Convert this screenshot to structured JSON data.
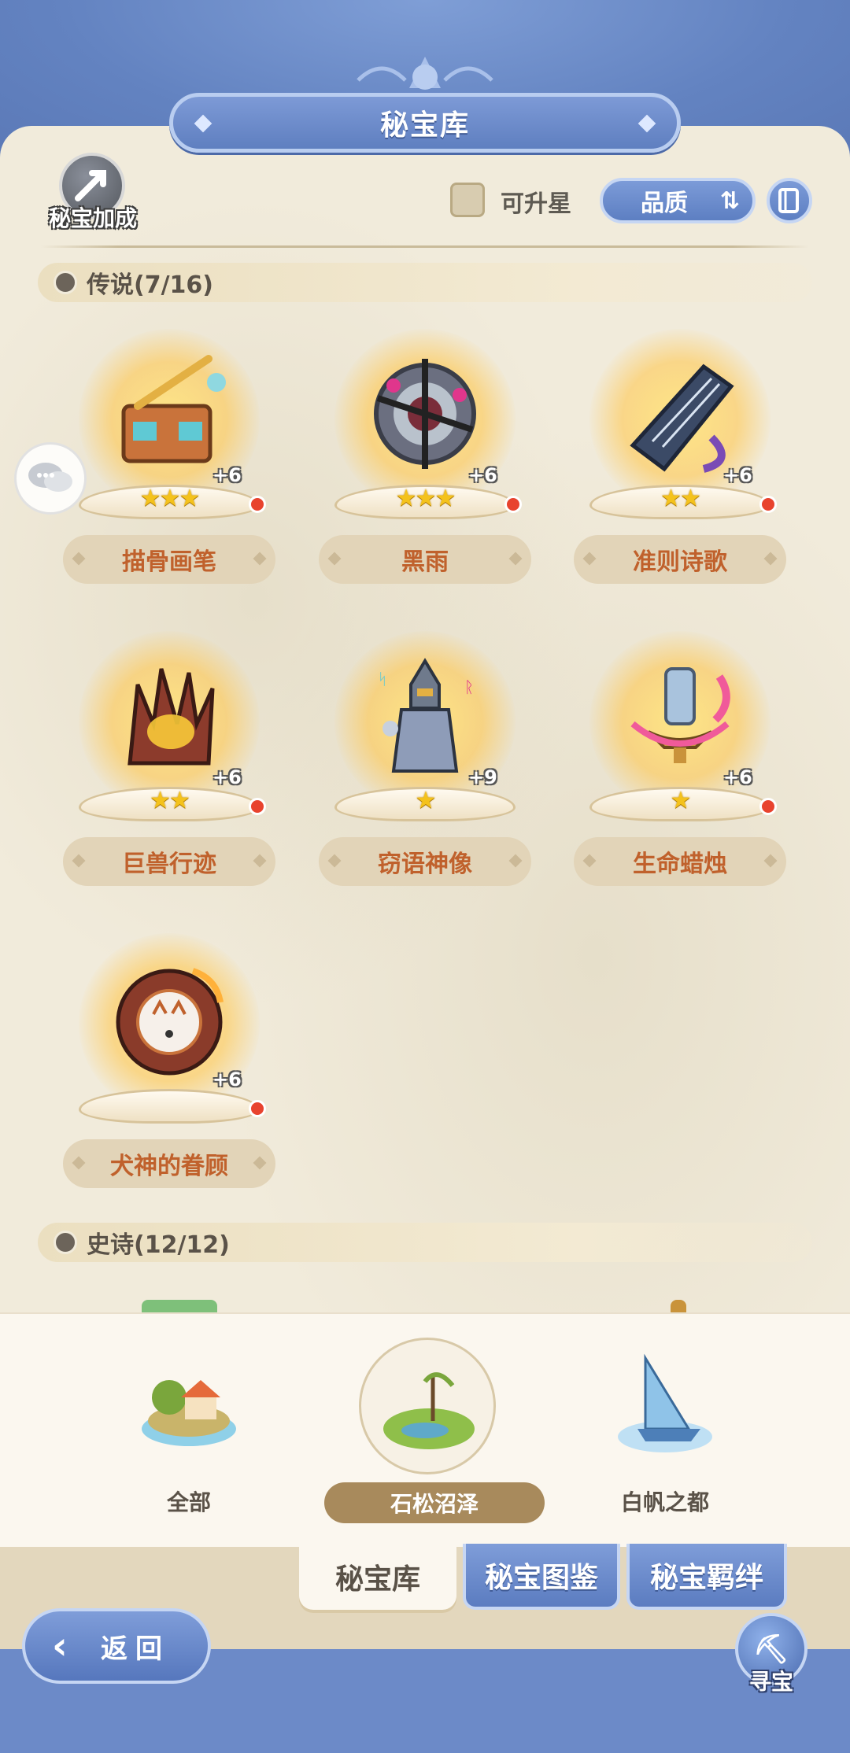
{
  "header": {
    "title": "秘宝库",
    "bonus_label": "秘宝加成",
    "upgrade_filter_label": "可升星",
    "quality_select_label": "品质",
    "sort_icon": "⇅",
    "book_icon": "book-icon"
  },
  "sections": [
    {
      "label": "传说(7/16)",
      "items": [
        {
          "name": "描骨画笔",
          "stars": "★★★",
          "level": "+6",
          "icon": "paintbrush-chest-icon",
          "accent": "#c9733b"
        },
        {
          "name": "黑雨",
          "stars": "★★★",
          "level": "+6",
          "icon": "black-rain-icon",
          "accent": "#6b6f80"
        },
        {
          "name": "准则诗歌",
          "stars": "★★",
          "level": "+6",
          "icon": "zither-icon",
          "accent": "#3b4a66"
        },
        {
          "name": "巨兽行迹",
          "stars": "★★",
          "level": "+6",
          "icon": "beast-claw-icon",
          "accent": "#8c3b2c"
        },
        {
          "name": "窃语神像",
          "stars": "★",
          "level": "+9",
          "icon": "whisper-statue-icon",
          "accent": "#8e9cb8"
        },
        {
          "name": "生命蜡烛",
          "stars": "★",
          "level": "+6",
          "icon": "life-candle-icon",
          "accent": "#a9c3dd"
        },
        {
          "name": "犬神的眷顾",
          "stars": "",
          "level": "+6",
          "icon": "dog-god-ring-icon",
          "accent": "#8a3b2a"
        }
      ]
    },
    {
      "label": "史诗(12/12)",
      "items": []
    }
  ],
  "regions": [
    {
      "label": "全部",
      "icon": "house-island-icon",
      "active": false
    },
    {
      "label": "石松沼泽",
      "icon": "swamp-island-icon",
      "active": true
    },
    {
      "label": "白帆之都",
      "icon": "sailboat-icon",
      "active": false
    }
  ],
  "tabs": [
    {
      "label": "秘宝库",
      "active": true
    },
    {
      "label": "秘宝图鉴",
      "active": false
    },
    {
      "label": "秘宝羁绊",
      "active": false
    }
  ],
  "footer": {
    "back_label": "返回",
    "hunt_label": "寻宝"
  },
  "colors": {
    "primary_blue": "#6383c1",
    "parchment": "#f1ebdb",
    "item_name": "#c0612c",
    "star": "#f4c21c",
    "notify_dot": "#e8432e"
  }
}
